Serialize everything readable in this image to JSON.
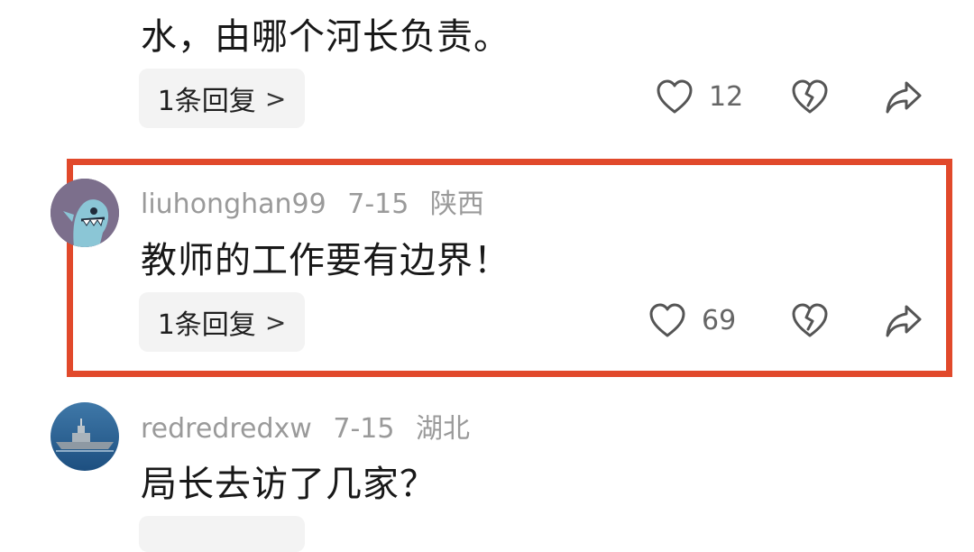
{
  "top_comment": {
    "text_tail": "水，由哪个河长负责。",
    "reply_label": "1条回复",
    "reply_chevron": ">",
    "like_count": "12"
  },
  "comments": [
    {
      "username": "liuhonghan99",
      "date": "7-15",
      "location": "陕西",
      "text": "教师的工作要有边界！",
      "reply_label": "1条回复",
      "reply_chevron": ">",
      "like_count": "69",
      "avatar": "cartoon-shark-avatar",
      "highlighted": true
    },
    {
      "username": "redredredxw",
      "date": "7-15",
      "location": "湖北",
      "text": "局长去访了几家？",
      "avatar": "warship-avatar",
      "highlighted": false
    }
  ],
  "icons": {
    "like": "heart-icon",
    "dislike": "broken-heart-icon",
    "share": "share-arrow-icon"
  },
  "colors": {
    "highlight_border": "#e1492b",
    "chip_bg": "#f3f3f3",
    "meta_text": "#9a9a9a"
  }
}
